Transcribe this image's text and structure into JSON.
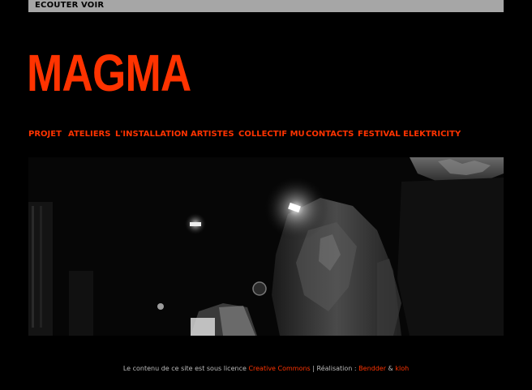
{
  "colors": {
    "accent": "#ff3300",
    "topbar": "#a6a6a6",
    "background": "#000000",
    "footer_text": "#bbbbbb"
  },
  "topbar": {
    "links": [
      "ECOUTER",
      "VOIR"
    ]
  },
  "logo": {
    "text": "MAGMA"
  },
  "nav": {
    "items": [
      "PROJET",
      "ATELIERS",
      "L'INSTALLATION",
      "ARTISTES",
      "COLLECTIF MU",
      "CONTACTS",
      "FESTIVAL ELEKTRICITY"
    ]
  },
  "hero": {
    "alt": "Dark underground tunnel photograph with lamps"
  },
  "footer": {
    "text_before": "Le contenu de ce site est sous licence ",
    "license_link": "Creative Commons",
    "separator": " | Réalisation : ",
    "credit_1": "Bendder",
    "and": " & ",
    "credit_2": "kloh"
  }
}
